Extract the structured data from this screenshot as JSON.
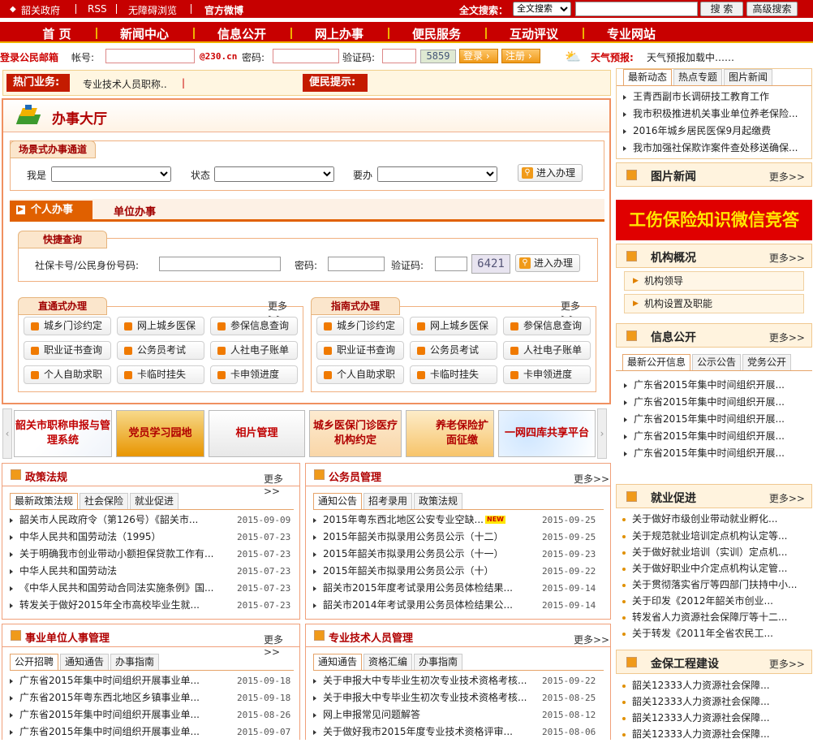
{
  "topbar": {
    "links": [
      "韶关政府",
      "RSS",
      "无障碍浏览",
      "官方微博"
    ],
    "search_label": "全文搜索：",
    "search_select": "全文搜索",
    "search_btn": "搜 索",
    "advanced_btn": "高级搜索"
  },
  "nav": [
    "首 页",
    "新闻中心",
    "信息公开",
    "网上办事",
    "便民服务",
    "互动评议",
    "专业网站"
  ],
  "login": {
    "title": "登录公民邮箱",
    "account": "帐号:",
    "domain": "@230.cn",
    "password": "密码:",
    "captcha": "验证码:",
    "captcha_img": "5859",
    "login_btn": "登录",
    "register_btn": "注册",
    "weather_label": "天气预报:",
    "weather_text": "天气预报加载中……"
  },
  "hot": {
    "label": "热门业务:",
    "text": "专业技术人员职称..",
    "notice": "便民提示:"
  },
  "hall": {
    "title": "办事大厅",
    "scene_title": "场景式办事通道",
    "iam": "我是",
    "status": "状态",
    "want": "要办",
    "enter": "进入办理",
    "tab_personal": "个人办事",
    "tab_unit": "单位办事",
    "quick_title": "快捷查询",
    "ss_label": "社保卡号/公民身份号码:",
    "pw_label": "密码:",
    "cap_label": "验证码:",
    "cap_img": "6421",
    "quick_enter": "进入办理",
    "direct": {
      "title": "直通式办理",
      "more": "更多>>",
      "buttons": [
        "城乡门诊约定",
        "网上城乡医保",
        "参保信息查询",
        "职业证书查询",
        "公务员考试",
        "人社电子账单",
        "个人自助求职",
        "卡临时挂失",
        "卡申领进度"
      ]
    },
    "guide": {
      "title": "指南式办理",
      "more": "更多>>",
      "buttons": [
        "城乡门诊约定",
        "网上城乡医保",
        "参保信息查询",
        "职业证书查询",
        "公务员考试",
        "人社电子账单",
        "个人自助求职",
        "卡临时挂失",
        "卡申领进度"
      ]
    }
  },
  "banners": [
    "韶关市职称申报与管理系统",
    "党员学习园地",
    "相片管理",
    "城乡医保门诊医疗机构约定",
    "养老保险扩面征缴",
    "一网四库共享平台"
  ],
  "policy": {
    "title": "政策法规",
    "more": "更多>>",
    "tabs": [
      "最新政策法规",
      "社会保险",
      "就业促进"
    ],
    "rows": [
      [
        "韶关市人民政府令（第126号）《韶关市...",
        "2015-09-09"
      ],
      [
        "中华人民共和国劳动法（1995）",
        "2015-07-23"
      ],
      [
        "关于明确我市创业带动小额担保贷款工作有...",
        "2015-07-23"
      ],
      [
        "中华人民共和国劳动法",
        "2015-07-23"
      ],
      [
        "《中华人民共和国劳动合同法实施条例》国...",
        "2015-07-23"
      ],
      [
        "转发关于做好2015年全市高校毕业生就...",
        "2015-07-23"
      ]
    ]
  },
  "civil": {
    "title": "公务员管理",
    "more": "更多>>",
    "tabs": [
      "通知公告",
      "招考录用",
      "政策法规"
    ],
    "new_badge": "NEW",
    "rows": [
      [
        "2015年粤东西北地区公安专业空缺...",
        "2015-09-25"
      ],
      [
        "2015年韶关市拟录用公务员公示（十二）",
        "2015-09-25"
      ],
      [
        "2015年韶关市拟录用公务员公示（十一）",
        "2015-09-23"
      ],
      [
        "2015年韶关市拟录用公务员公示（十）",
        "2015-09-22"
      ],
      [
        "韶关市2015年度考试录用公务员体检结果...",
        "2015-09-14"
      ],
      [
        "韶关市2014年考试录用公务员体检结果公...",
        "2015-09-14"
      ]
    ]
  },
  "inst": {
    "title": "事业单位人事管理",
    "more": "更多>>",
    "tabs": [
      "公开招聘",
      "通知通告",
      "办事指南"
    ],
    "rows": [
      [
        "广东省2015年集中时间组织开展事业单...",
        "2015-09-18"
      ],
      [
        "广东省2015年粤东西北地区乡镇事业单...",
        "2015-09-18"
      ],
      [
        "广东省2015年集中时间组织开展事业单...",
        "2015-08-26"
      ],
      [
        "广东省2015年集中时间组织开展事业单...",
        "2015-09-07"
      ]
    ]
  },
  "prof": {
    "title": "专业技术人员管理",
    "more": "更多>>",
    "tabs": [
      "通知通告",
      "资格汇编",
      "办事指南"
    ],
    "rows": [
      [
        "关于申报大中专毕业生初次专业技术资格考核...",
        "2015-09-22"
      ],
      [
        "关于申报大中专毕业生初次专业技术资格考核...",
        "2015-08-25"
      ],
      [
        "网上申报常见问题解答",
        "2015-08-12"
      ],
      [
        "关于做好我市2015年度专业技术资格评审...",
        "2015-08-06"
      ]
    ]
  },
  "right": {
    "tabs": [
      "最新动态",
      "热点专题",
      "图片新闻"
    ],
    "news": [
      "王青西副市长调研技工教育工作",
      "我市积极推进机关事业单位养老保险...",
      "2016年城乡居民医保9月起缴费",
      "我市加强社保欺诈案件查处移送确保..."
    ],
    "photo": {
      "title": "图片新闻",
      "more": "更多>>"
    },
    "quiz": "工伤保险知识微信竞答",
    "org": {
      "title": "机构概况",
      "more": "更多>>",
      "items": [
        "机构领导",
        "机构设置及职能"
      ]
    },
    "info": {
      "title": "信息公开",
      "more": "更多>>",
      "tabs": [
        "最新公开信息",
        "公示公告",
        "党务公开"
      ],
      "rows": [
        "广东省2015年集中时间组织开展...",
        "广东省2015年集中时间组织开展...",
        "广东省2015年集中时间组织开展...",
        "广东省2015年集中时间组织开展...",
        "广东省2015年集中时间组织开展..."
      ]
    },
    "emp": {
      "title": "就业促进",
      "more": "更多>>",
      "rows": [
        "关于做好市级创业带动就业孵化...",
        "关于规范就业培训定点机构认定等...",
        "关于做好就业培训（实训）定点机...",
        "关于做好职业中介定点机构认定管...",
        "关于贯彻落实省厅等四部门扶持中小...",
        "关于印发《2012年韶关市创业...",
        "转发省人力资源社会保障厅等十二...",
        "关于转发《2011年全省农民工..."
      ]
    },
    "gold": {
      "title": "金保工程建设",
      "more": "更多>>",
      "rows": [
        "韶关12333人力资源社会保障...",
        "韶关12333人力资源社会保障...",
        "韶关12333人力资源社会保障...",
        "韶关12333人力资源社会保障..."
      ]
    }
  }
}
